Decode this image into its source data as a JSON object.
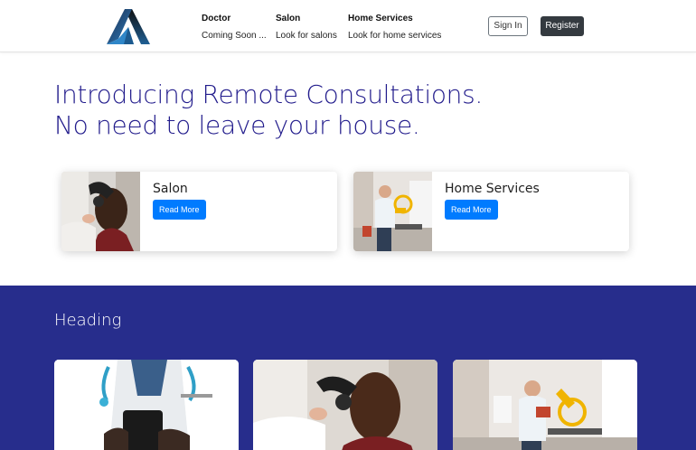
{
  "header": {
    "logo_icon": "triangle-logo-icon",
    "nav": [
      {
        "title": "Doctor",
        "subtitle": "Coming Soon ..."
      },
      {
        "title": "Salon",
        "subtitle": "Look for salons"
      },
      {
        "title": "Home Services",
        "subtitle": "Look for home services"
      }
    ],
    "signin_label": "Sign In",
    "register_label": "Register"
  },
  "hero": {
    "title_line1": "Introducing Remote Consultations.",
    "title_line2": "No need to leave your house."
  },
  "service_cards": [
    {
      "title": "Salon",
      "button_label": "Read More",
      "image": "hair-salon-photo"
    },
    {
      "title": "Home Services",
      "button_label": "Read More",
      "image": "handyman-saw-photo"
    }
  ],
  "section": {
    "heading": "Heading",
    "gallery": [
      {
        "image": "doctor-phone-photo"
      },
      {
        "image": "hair-salon-photo"
      },
      {
        "image": "handyman-saw-photo"
      }
    ]
  },
  "colors": {
    "hero_text": "#221c8c",
    "section_bg": "#272d8c",
    "primary_button": "#007bff",
    "dark_button": "#343a40"
  }
}
